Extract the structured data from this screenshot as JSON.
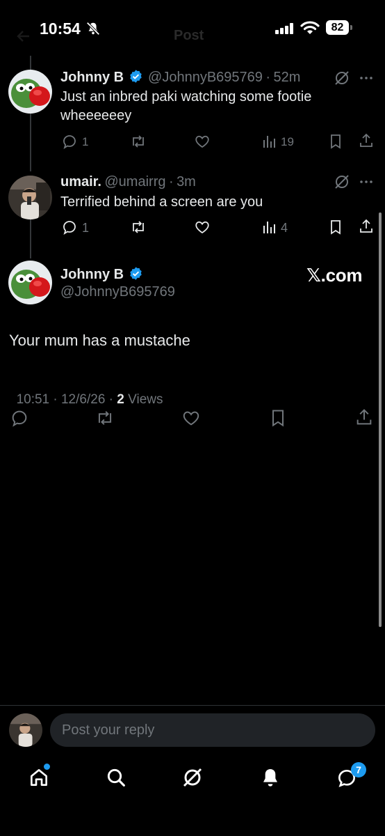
{
  "status_bar": {
    "time": "10:54",
    "battery": "82"
  },
  "header": {
    "title": "Post"
  },
  "tweet1": {
    "name": "Johnny B",
    "handle": "@JohnnyB695769",
    "sep": "·",
    "time": "52m",
    "text_line1": "Just an inbred paki watching some footie",
    "text_line2": "wheeeeeey",
    "replies": "1",
    "views": "19"
  },
  "tweet2": {
    "name": "umair.",
    "handle": "@umairrg",
    "sep": "·",
    "time": "3m",
    "text": "Terrified behind a screen are you",
    "replies": "1",
    "views": "4"
  },
  "main_tweet": {
    "name": "Johnny B",
    "handle": "@JohnnyB695769",
    "watermark": "𝕏.com",
    "text": "Your mum has a mustache",
    "time": "10:51 · 12/6/26 · ",
    "views_count": "2",
    "views_label": " Views"
  },
  "reply_bar": {
    "placeholder": "Post your reply"
  },
  "bottom_nav": {
    "messages_badge": "7"
  },
  "colors": {
    "accent": "#1d9bf0",
    "background": "#000000",
    "muted": "#71767b"
  }
}
